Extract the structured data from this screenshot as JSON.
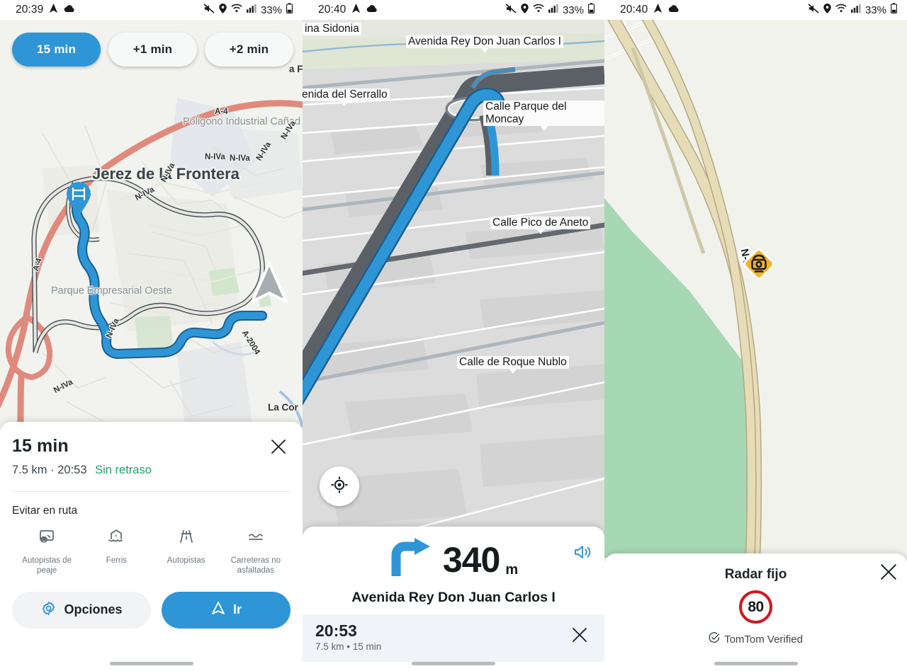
{
  "app": {
    "name": "TomTom GO Navigation",
    "accent": "#2e96d6",
    "green": "#22a06b",
    "red": "#d0181f",
    "amber": "#f5b32b"
  },
  "screens": [
    {
      "id": "route-overview",
      "statusbar": {
        "time": "20:39",
        "battery": "33%",
        "icons": [
          "navigation-icon",
          "cloud-icon",
          "mute-icon",
          "location-icon",
          "wifi-icon",
          "signal-icon",
          "battery-icon"
        ]
      },
      "chips": [
        {
          "label": "15 min",
          "selected": true
        },
        {
          "label": "+1 min",
          "selected": false
        },
        {
          "label": "+2 min",
          "selected": false
        }
      ],
      "map": {
        "city": "Jerez de la Frontera",
        "labels": [
          {
            "text": "Poligono Industrial Cañad",
            "kind": "poi"
          },
          {
            "text": "Parque Empresarial Oeste",
            "kind": "poi"
          },
          {
            "text": "La Cor",
            "kind": "place"
          },
          {
            "text": "a F",
            "kind": "place"
          }
        ],
        "shields": [
          "A-4",
          "A-4",
          "N-IVa",
          "N-IVa",
          "N-IVa",
          "N-IVa",
          "N-IVa",
          "N-IVa",
          "N-IVa",
          "A-2004"
        ]
      },
      "sheet": {
        "eta_title": "15 min",
        "distance": "7.5 km",
        "separator": "·",
        "arrival": "20:53",
        "delay": "Sin retraso",
        "avoid_title": "Evitar en ruta",
        "avoid": [
          {
            "label": "Autopistas de peaje",
            "icon": "toll-icon"
          },
          {
            "label": "Ferris",
            "icon": "ferry-icon"
          },
          {
            "label": "Autopistas",
            "icon": "motorway-icon"
          },
          {
            "label": "Carreteras no asfaltadas",
            "icon": "unpaved-road-icon"
          }
        ],
        "options_label": "Opciones",
        "go_label": "Ir",
        "close_icon": "close-icon"
      }
    },
    {
      "id": "turn-by-turn",
      "statusbar": {
        "time": "20:40",
        "battery": "33%"
      },
      "map": {
        "streets": [
          {
            "text": "ina Sidonia"
          },
          {
            "text": "Avenida Rey Don Juan Carlos I"
          },
          {
            "text": "enida del Serrallo"
          },
          {
            "text": "Calle Parque del Moncay"
          },
          {
            "text": "Calle Pico de Aneto"
          },
          {
            "text": "Calle de Roque Nublo"
          }
        ],
        "recenter_icon": "recenter-icon"
      },
      "nav": {
        "maneuver_icon": "turn-right-icon",
        "distance": "340",
        "distance_unit": "m",
        "street": "Avenida Rey Don Juan Carlos I",
        "sound_icon": "volume-on-icon",
        "eta_time": "20:53",
        "eta_detail": "7.5 km • 15 min",
        "close_icon": "close-icon"
      }
    },
    {
      "id": "speed-camera",
      "statusbar": {
        "time": "20:40",
        "battery": "33%"
      },
      "map": {
        "road_shield": "N-I",
        "marker_icon": "speed-camera-icon"
      },
      "radar": {
        "title": "Radar fijo",
        "speed_limit": "80",
        "verified_label": "TomTom Verified",
        "verified_icon": "check-circle-icon",
        "close_icon": "close-icon"
      }
    }
  ]
}
